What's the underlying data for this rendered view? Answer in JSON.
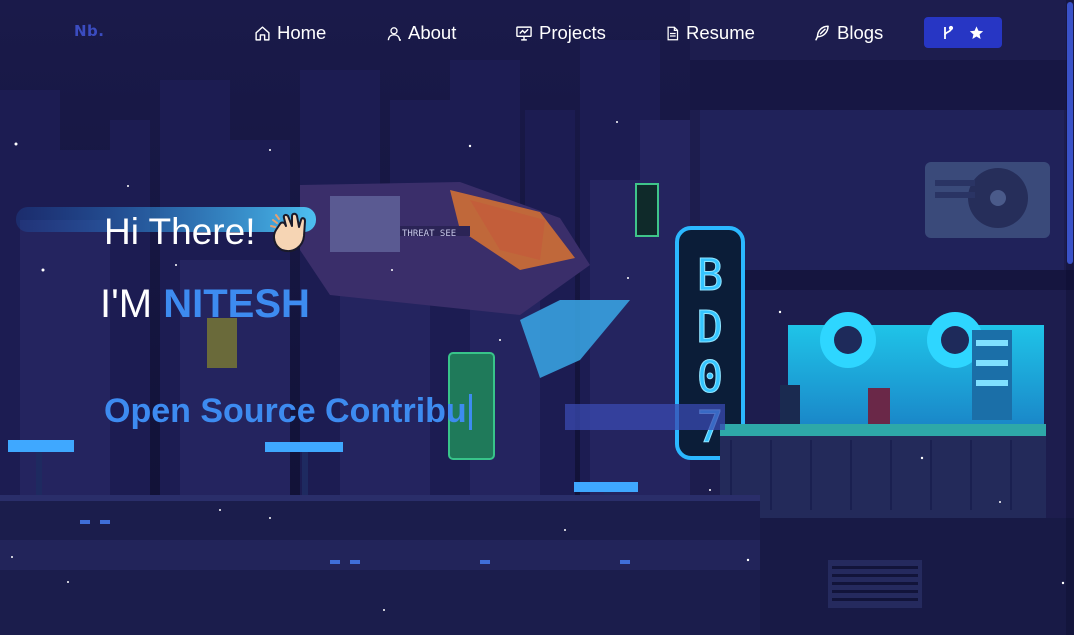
{
  "nav": {
    "logo": "Nb.",
    "items": [
      {
        "label": "Home",
        "icon": "home-icon"
      },
      {
        "label": "About",
        "icon": "user-icon"
      },
      {
        "label": "Projects",
        "icon": "presentation-icon"
      },
      {
        "label": "Resume",
        "icon": "document-icon"
      },
      {
        "label": "Blogs",
        "icon": "feather-icon"
      }
    ],
    "star_button": {
      "icons": [
        "fork-icon",
        "star-icon"
      ]
    }
  },
  "hero": {
    "greeting": "Hi There!",
    "name_prefix": "I'M",
    "name": "NITESH",
    "typed_text": "Open Source Contribu"
  },
  "colors": {
    "accent": "#3d8bf0",
    "button": "#2736c4",
    "logo": "#3b4cc0",
    "background": "#12123a"
  }
}
